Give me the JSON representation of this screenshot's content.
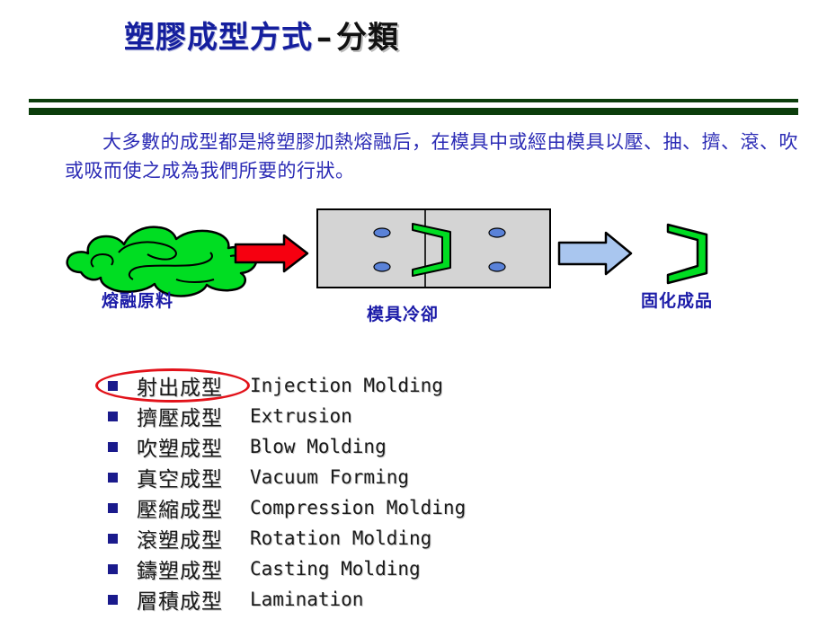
{
  "title": {
    "main": "塑膠成型方式",
    "dash": "–",
    "sub": "分類"
  },
  "intro": {
    "paragraph": "大多數的成型都是將塑膠加熱熔融后，在模具中或經由模具以壓、抽、擠、滾、吹或吸而使之成為我們所要的行狀。"
  },
  "diagram": {
    "labels": {
      "melt": "熔融原料",
      "mold": "模具冷卻",
      "solid": "固化成品"
    },
    "colors": {
      "molten_green": "#00dd22",
      "red_arrow": "#f60010",
      "blue_arrow": "#a9c6ef",
      "mold_gray": "#d4d4d4",
      "channel_blue": "#5a82d8",
      "outline": "#000000"
    },
    "shapes": {
      "molten_blob": "molten-plastic-blob",
      "arrow_in": "red-right-arrow",
      "mold_block": "mold-cavity-block",
      "part_in_mold": "green-bracket-part",
      "arrow_out": "blue-right-arrow",
      "finished_part": "green-bracket-part",
      "cooling_channels": 4
    }
  },
  "methods": {
    "items": [
      {
        "zh": "射出成型",
        "en": "Injection Molding",
        "highlighted": true
      },
      {
        "zh": "擠壓成型",
        "en": "Extrusion",
        "highlighted": false
      },
      {
        "zh": "吹塑成型",
        "en": "Blow Molding",
        "highlighted": false
      },
      {
        "zh": "真空成型",
        "en": "Vacuum Forming",
        "highlighted": false
      },
      {
        "zh": "壓縮成型",
        "en": "Compression Molding",
        "highlighted": false
      },
      {
        "zh": "滾塑成型",
        "en": "Rotation Molding",
        "highlighted": false
      },
      {
        "zh": "鑄塑成型",
        "en": "Casting Molding",
        "highlighted": false
      },
      {
        "zh": "層積成型",
        "en": "Lamination",
        "highlighted": false
      }
    ],
    "bullet_color": "#1a1a8c",
    "highlight_color": "#e2121a"
  }
}
